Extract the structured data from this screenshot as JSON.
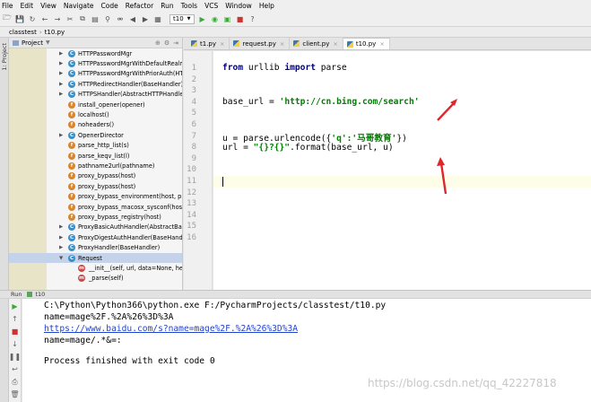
{
  "menu": [
    "File",
    "Edit",
    "View",
    "Navigate",
    "Code",
    "Refactor",
    "Run",
    "Tools",
    "VCS",
    "Window",
    "Help"
  ],
  "toolbar": {
    "run_config": "t10"
  },
  "breadcrumb": [
    "classtest",
    "t10.py"
  ],
  "left_stripe": "1: Project",
  "project_panel": {
    "title": "Project",
    "tree": [
      {
        "label": "HTTPPasswordMgr",
        "badge": "C",
        "color": "#3a8fc9"
      },
      {
        "label": "HTTPPasswordMgrWithDefaultRealm",
        "badge": "C",
        "color": "#3a8fc9"
      },
      {
        "label": "HTTPPasswordMgrWithPriorAuth(HT",
        "badge": "C",
        "color": "#3a8fc9"
      },
      {
        "label": "HTTPRedirectHandler(BaseHandler)",
        "badge": "C",
        "color": "#3a8fc9"
      },
      {
        "label": "HTTPSHandler(AbstractHTTPHandler)",
        "badge": "C",
        "color": "#3a8fc9"
      },
      {
        "label": "install_opener(opener)",
        "badge": "f",
        "color": "#d9852d"
      },
      {
        "label": "localhost()",
        "badge": "f",
        "color": "#d9852d"
      },
      {
        "label": "noheaders()",
        "badge": "f",
        "color": "#d9852d"
      },
      {
        "label": "OpenerDirector",
        "badge": "C",
        "color": "#3a8fc9"
      },
      {
        "label": "parse_http_list(s)",
        "badge": "f",
        "color": "#d9852d"
      },
      {
        "label": "parse_keqv_list(l)",
        "badge": "f",
        "color": "#d9852d"
      },
      {
        "label": "pathname2url(pathname)",
        "badge": "f",
        "color": "#d9852d"
      },
      {
        "label": "proxy_bypass(host)",
        "badge": "f",
        "color": "#d9852d"
      },
      {
        "label": "proxy_bypass(host)",
        "badge": "f",
        "color": "#d9852d"
      },
      {
        "label": "proxy_bypass_environment(host, pro",
        "badge": "f",
        "color": "#d9852d"
      },
      {
        "label": "proxy_bypass_macosx_sysconf(host)",
        "badge": "f",
        "color": "#d9852d"
      },
      {
        "label": "proxy_bypass_registry(host)",
        "badge": "f",
        "color": "#d9852d"
      },
      {
        "label": "ProxyBasicAuthHandler(AbstractBasic",
        "badge": "C",
        "color": "#3a8fc9"
      },
      {
        "label": "ProxyDigestAuthHandler(BaseHandle",
        "badge": "C",
        "color": "#3a8fc9"
      },
      {
        "label": "ProxyHandler(BaseHandler)",
        "badge": "C",
        "color": "#3a8fc9"
      },
      {
        "label": "Request",
        "badge": "C",
        "color": "#3a8fc9"
      },
      {
        "label": "__init__(self, url, data=None, head",
        "badge": "m",
        "color": "#c94a4a"
      },
      {
        "label": "_parse(self)",
        "badge": "m",
        "color": "#c94a4a"
      }
    ]
  },
  "tabs": [
    {
      "label": "t1.py",
      "active": false
    },
    {
      "label": "request.py",
      "active": false
    },
    {
      "label": "client.py",
      "active": false
    },
    {
      "label": "t10.py",
      "active": true
    }
  ],
  "editor": {
    "line_numbers": [
      "1",
      "2",
      "3",
      "4",
      "5",
      "6",
      "7",
      "8",
      "9",
      "10",
      "11",
      "12",
      "13",
      "14",
      "15",
      "16"
    ],
    "line1": {
      "kw1": "from",
      "mid": " urllib ",
      "kw2": "import",
      "rest": " parse"
    },
    "line4": {
      "pre": "base_url = ",
      "str": "'http://cn.bing.com/search'"
    },
    "line7": {
      "pre": "u = parse.urlencode({",
      "str": "'q':'马哥教育'",
      "post": "})"
    },
    "line8": {
      "pre": "url = ",
      "str": "\"{}?{}\"",
      "post": ".format(base_url, u)"
    }
  },
  "run": {
    "label": "Run",
    "config": "t10",
    "output": [
      "C:\\Python\\Python366\\python.exe F:/PycharmProjects/classtest/t10.py",
      "name=mage%2F.%2A%26%3D%3A",
      "https://www.baidu.com/s?name=mage%2F.%2A%26%3D%3A",
      "name=mage/.*&=:",
      "",
      "Process finished with exit code 0"
    ]
  },
  "annotation_color": "#e0262a",
  "watermark": "https://blog.csdn.net/qq_42227818"
}
